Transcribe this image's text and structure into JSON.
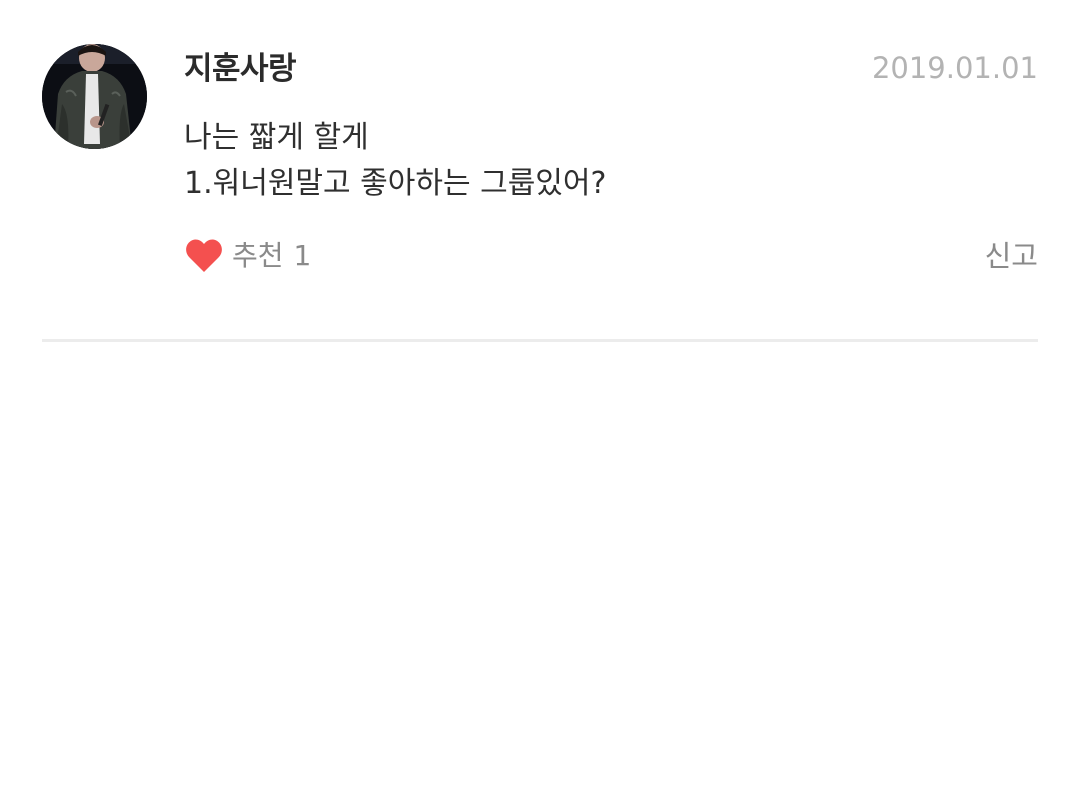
{
  "comment": {
    "author": "지훈사랑",
    "date": "2019.01.01",
    "avatar_icon": "user-photo-avatar",
    "lines": [
      "나는 짧게 할게",
      "1.워너원말고 좋아하는 그룹있어?"
    ],
    "like": {
      "icon": "heart-icon",
      "icon_color": "#f4504f",
      "label": "추천",
      "count": "1"
    },
    "report_label": "신고"
  }
}
